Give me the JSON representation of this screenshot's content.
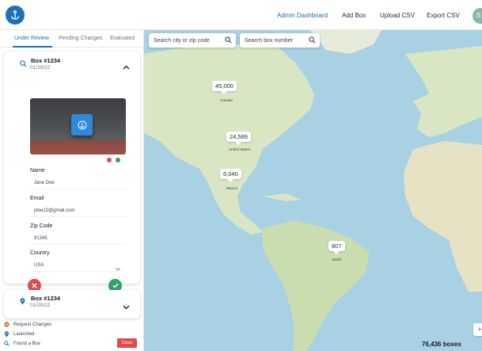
{
  "nav": {
    "links": [
      "Admin Dashboard",
      "Add Box",
      "Upload CSV",
      "Export CSV"
    ],
    "avatar_initial": "S"
  },
  "sidebar": {
    "tabs": [
      "Under Review",
      "Pending Changes",
      "Evaluated"
    ],
    "cards": [
      {
        "title": "Box #1234",
        "date": "01/20/22",
        "expanded": true
      },
      {
        "title": "Box #1234",
        "date": "01/20/22",
        "expanded": false
      }
    ],
    "form": {
      "name_label": "Name",
      "name_value": "Jane Doe",
      "email_label": "Email",
      "email_value": "jdoe12@gmail.com",
      "zip_label": "Zip Code",
      "zip_value": "91345",
      "country_label": "Country",
      "country_value": "USA"
    },
    "legend": [
      "Request Changes",
      "Launched",
      "Found a Box"
    ],
    "close_label": "Close"
  },
  "map": {
    "search_city_placeholder": "Search city or zip code",
    "search_box_placeholder": "Search box number",
    "clusters": [
      "45,000",
      "24,589",
      "6,040",
      "807"
    ],
    "region_labels": [
      "Canada",
      "United States",
      "Mexico",
      "Brazil"
    ],
    "box_count": "76,436 boxes"
  },
  "colors": {
    "accent": "#1d6fb8",
    "reject": "#e04b4b",
    "approve": "#2fa36b",
    "water": "#a9d1e4",
    "land": "#d8e6c3"
  }
}
